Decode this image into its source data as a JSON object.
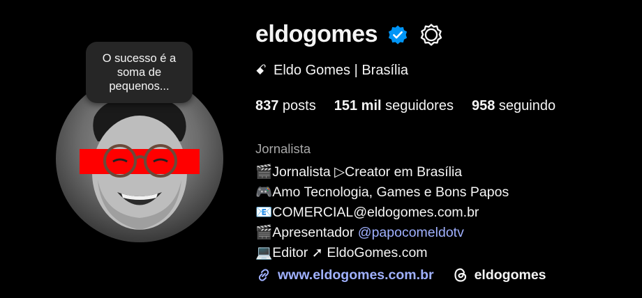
{
  "note": {
    "text": "O sucesso é a\nsoma de\npequenos..."
  },
  "profile": {
    "username": "eldogomes",
    "full_name_glyph": "ꗃ",
    "full_name": "Eldo Gomes | Brasília",
    "category": "Jornalista",
    "verified": true
  },
  "stats": {
    "posts_count": "837",
    "posts_label": " posts",
    "followers_count": "151 mil",
    "followers_label": " seguidores",
    "following_count": "958",
    "following_label": " seguindo"
  },
  "bio": {
    "line1": "🎬Jornalista ▷Creator em Brasília",
    "line2": "🎮Amo Tecnologia, Games e Bons Papos",
    "line3": "📧COMERCIAL@eldogomes.com.br",
    "line4_prefix": "🎬Apresentador ",
    "line4_mention": "@papocomeldotv",
    "line5": "💻Editor ➚ EldoGomes.com"
  },
  "links": {
    "website": "www.eldogomes.com.br",
    "threads_handle": "eldogomes"
  },
  "icons": {
    "verified": "verified-badge-icon",
    "settings": "settings-gear-icon",
    "link": "link-icon",
    "threads": "threads-icon"
  },
  "colors": {
    "verified": "#0095f6",
    "link": "#a0b1ff",
    "accent_red": "#ff0000"
  }
}
